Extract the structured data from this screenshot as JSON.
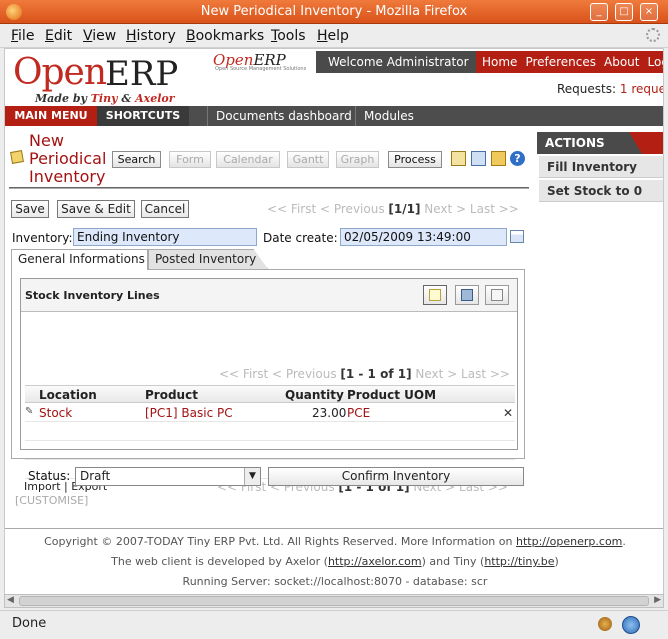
{
  "window": {
    "title": "New Periodical Inventory - Mozilla Firefox",
    "minimize": "_",
    "maximize": "□",
    "close": "×"
  },
  "menu": [
    "File",
    "Edit",
    "View",
    "History",
    "Bookmarks",
    "Tools",
    "Help"
  ],
  "header": {
    "logo_open": "Open",
    "logo_erp": "ERP",
    "made_by_prefix": "Made by ",
    "made_by_tiny": "Tiny",
    "made_by_amp": " & ",
    "made_by_axelor": "Axelor",
    "small_logo_open": "Open",
    "small_logo_erp": "ERP",
    "small_logo_sub": "Open Source Management Solutions",
    "welcome": "Welcome Administrator",
    "nav": [
      "Home",
      "Preferences",
      "About",
      "Logout"
    ],
    "requests_label": "Requests:",
    "requests_value": "1 reque"
  },
  "mainbar": {
    "main_menu": "MAIN MENU",
    "shortcuts": "SHORTCUTS",
    "links": [
      "Documents dashboard",
      "Modules"
    ]
  },
  "page": {
    "title": "New Periodical Inventory",
    "toolbar": [
      "Search",
      "Form",
      "Calendar",
      "Gantt",
      "Graph",
      "Process"
    ],
    "buttons": {
      "save": "Save",
      "save_edit": "Save & Edit",
      "cancel": "Cancel"
    },
    "pager": {
      "prefix": "<< First < Previous ",
      "current": "[1/1]",
      "suffix": " Next > Last >>"
    }
  },
  "form": {
    "inventory_label": "Inventory:",
    "inventory_value": "Ending Inventory",
    "date_label": "Date create:",
    "date_value": "02/05/2009 13:49:00",
    "tabs": [
      "General Informations",
      "Posted Inventory"
    ]
  },
  "lines": {
    "title": "Stock Inventory Lines",
    "pager_prefix": "<< First < Previous ",
    "pager_current": "[1 - 1 of 1]",
    "pager_suffix": " Next > Last >>",
    "columns": [
      "Location",
      "Product",
      "Quantity",
      "Product UOM"
    ],
    "rows": [
      {
        "location": "Stock",
        "product": "[PC1] Basic PC",
        "quantity": "23.00",
        "uom": "PCE"
      }
    ],
    "delete_glyph": "✕",
    "footer_import": "Import",
    "footer_sep": " | ",
    "footer_export": "Export"
  },
  "status": {
    "label": "Status:",
    "value": "Draft",
    "confirm": "Confirm Inventory",
    "customise": "[CUSTOMISE]"
  },
  "actions": {
    "title": "ACTIONS",
    "items": [
      "Fill Inventory",
      "Set Stock to 0"
    ]
  },
  "footer": {
    "line1": "Copyright © 2007-TODAY Tiny ERP Pvt. Ltd. All Rights Reserved. More Information on ",
    "line1_link": "http://openerp.com",
    "line1_end": ".",
    "line2": "The web client is developed by Axelor (",
    "line2_link1": "http://axelor.com",
    "line2_mid": ") and Tiny (",
    "line2_link2": "http://tiny.be",
    "line2_end": ")",
    "line3": "Running Server: socket://localhost:8070 - database: scr"
  },
  "statusbar": {
    "text": "Done"
  },
  "colors": {
    "brand_red": "#b31f13",
    "title_red": "#a31212",
    "field_bg": "#dde8fb",
    "bar_dark": "#4d4d4d",
    "titlebar": "#e0621f"
  },
  "icons": [
    "firefox-icon",
    "edit-icon",
    "print-icon",
    "attachment-icon",
    "translate-icon",
    "help-icon",
    "calendar-icon",
    "new-line-icon",
    "save-line-icon",
    "edit-line-icon",
    "delete-icon",
    "dropdown-arrow-icon",
    "throbber-icon",
    "bug-icon",
    "world-icon"
  ]
}
